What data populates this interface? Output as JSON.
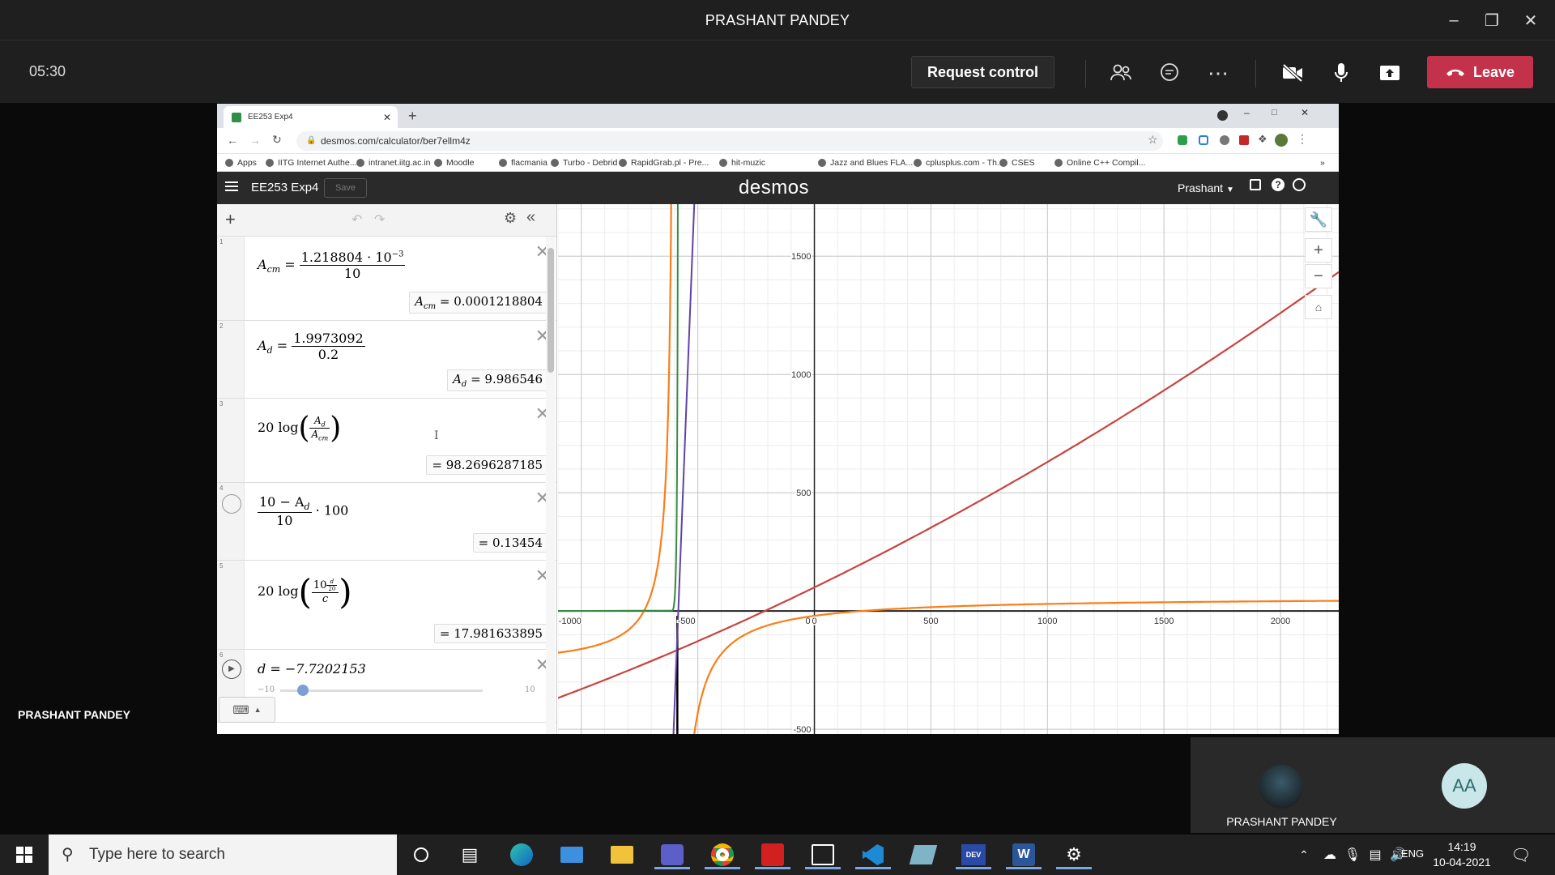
{
  "teams": {
    "window_title": "PRASHANT PANDEY",
    "call_timer": "05:30",
    "request_control_label": "Request control",
    "leave_label": "Leave",
    "presenter_name": "PRASHANT PANDEY",
    "tiles": [
      {
        "name": "PRASHANT PANDEY",
        "initials": ""
      },
      {
        "name": "",
        "initials": "AA"
      }
    ]
  },
  "browser": {
    "tab_title": "EE253 Exp4",
    "url": "desmos.com/calculator/ber7ellm4z",
    "bookmarks": [
      "Apps",
      "IITG Internet Authe...",
      "intranet.iitg.ac.in",
      "Moodle",
      "flacmania",
      "Turbo - Debrid",
      "RapidGrab.pl - Pre...",
      "hit-muzic",
      "Jazz and Blues FLA...",
      "cplusplus.com - Th...",
      "CSES",
      "Online C++ Compil..."
    ]
  },
  "desmos": {
    "graph_title": "EE253 Exp4",
    "save_label": "Save",
    "logo": "desmos",
    "user": "Prashant",
    "expressions": [
      {
        "num": "1",
        "lhs": "A",
        "sub": "cm",
        "numerator": "1.218804 · 10",
        "exp": "−3",
        "denominator": "10",
        "result_lhs": "A",
        "result_sub": "cm",
        "result": "0.0001218804"
      },
      {
        "num": "2",
        "lhs": "A",
        "sub": "d",
        "numerator": "1.9973092",
        "denominator": "0.2",
        "result_lhs": "A",
        "result_sub": "d",
        "result": "9.986546"
      },
      {
        "num": "3",
        "text": "20 log",
        "inner_num": "A",
        "inner_num_sub": "d",
        "inner_den": "A",
        "inner_den_sub": "cm",
        "result": "98.2696287185"
      },
      {
        "num": "4",
        "numerator": "10 − A",
        "numerator_sub": "d",
        "denominator": "10",
        "tail": "· 100",
        "result": "0.13454"
      },
      {
        "num": "5",
        "text": "20 log",
        "inner_num": "10",
        "inner_exp_num": "d",
        "inner_exp_den": "20",
        "inner_den": "c",
        "result": "17.981633895"
      },
      {
        "num": "6",
        "text": "d = −7.7202153",
        "slider_min": "−10",
        "slider_max": "10",
        "slider_value": -7.7202153
      }
    ],
    "x_axis": {
      "min": -1100,
      "max": 2250,
      "ticks": [
        -1000,
        -500,
        0,
        500,
        1000,
        1500,
        2000
      ]
    },
    "y_axis": {
      "min": -520,
      "max": 1720,
      "ticks": [
        -500,
        500,
        1000,
        1500
      ]
    }
  },
  "taskbar": {
    "search_placeholder": "Type here to search",
    "lang": "ENG",
    "time": "14:19",
    "date": "10-04-2021"
  }
}
